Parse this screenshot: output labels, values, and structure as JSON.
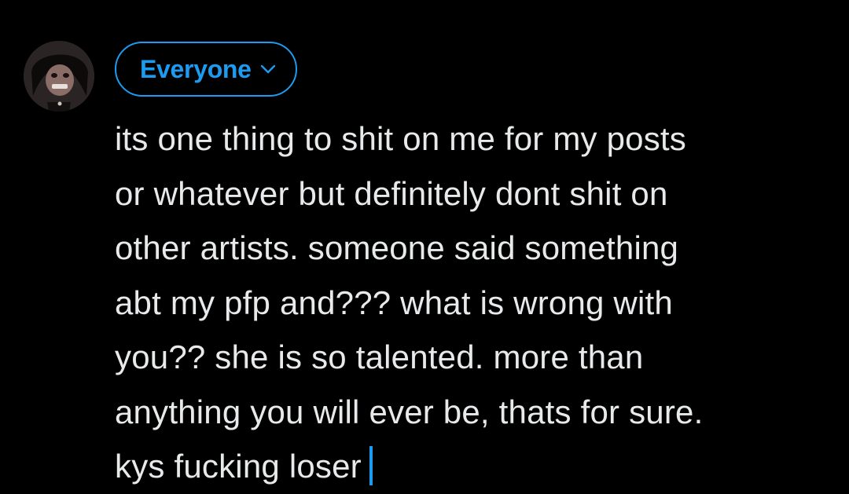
{
  "audience": {
    "label": "Everyone",
    "icon": "chevron-down-icon"
  },
  "avatar": {
    "icon": "profile-avatar"
  },
  "composer": {
    "lines": [
      "its one thing to shit on me for my posts",
      "or whatever but definitely dont shit on",
      "other artists. someone said something",
      "abt my pfp and??? what is wrong with",
      "you?? she is so talented. more than",
      "anything you will ever be, thats for sure.",
      "kys fucking loser"
    ]
  },
  "colors": {
    "background": "#000000",
    "accent": "#1d9bf0",
    "text": "#e7e9ea"
  }
}
